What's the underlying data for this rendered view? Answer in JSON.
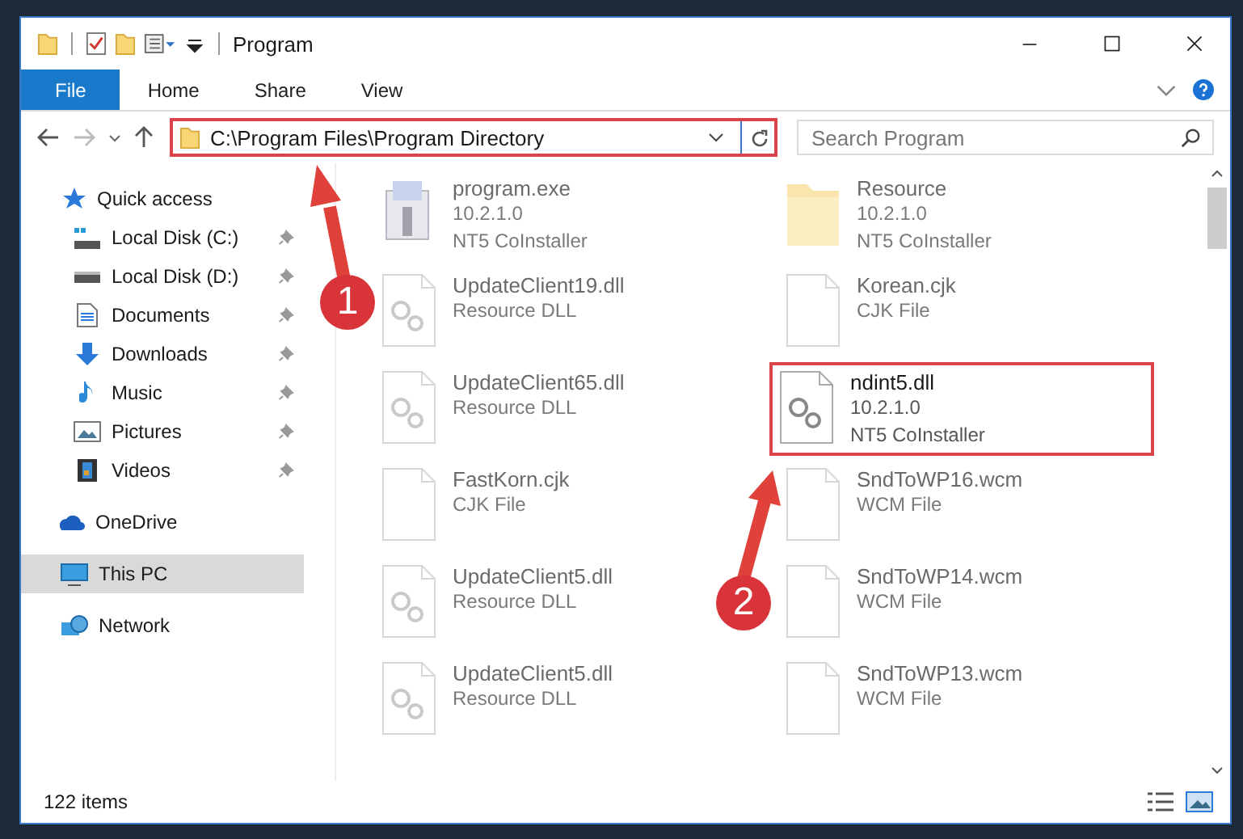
{
  "window": {
    "title": "Program"
  },
  "ribbon_tabs": [
    {
      "label": "File",
      "selected": true
    },
    {
      "label": "Home",
      "selected": false
    },
    {
      "label": "Share",
      "selected": false
    },
    {
      "label": "View",
      "selected": false
    }
  ],
  "address_bar": {
    "path": "C:\\Program Files\\Program Directory",
    "highlighted": true
  },
  "search": {
    "placeholder": "Search Program"
  },
  "navigation": [
    {
      "label": "Quick access",
      "kind": "star",
      "selected": false,
      "children": [
        {
          "label": "Local Disk (C:)",
          "kind": "drive-c",
          "pinned": true,
          "selected": false
        },
        {
          "label": "Local Disk (D:)",
          "kind": "drive",
          "pinned": true,
          "selected": false
        },
        {
          "label": "Documents",
          "kind": "document",
          "pinned": true,
          "selected": false
        },
        {
          "label": "Downloads",
          "kind": "download",
          "pinned": true,
          "selected": false
        },
        {
          "label": "Music",
          "kind": "music",
          "pinned": true,
          "selected": false
        },
        {
          "label": "Pictures",
          "kind": "pictures",
          "pinned": true,
          "selected": false
        },
        {
          "label": "Videos",
          "kind": "videos",
          "pinned": true,
          "selected": false
        }
      ]
    },
    {
      "label": "OneDrive",
      "kind": "cloud",
      "selected": false
    },
    {
      "label": "This PC",
      "kind": "pc",
      "selected": true
    },
    {
      "label": "Network",
      "kind": "network",
      "selected": false
    }
  ],
  "files": [
    {
      "name": "program.exe",
      "lines": [
        "10.2.1.0",
        "NT5 CoInstaller"
      ],
      "kind": "exe",
      "dimmed": true,
      "highlighted": false
    },
    {
      "name": "Resource",
      "lines": [
        "10.2.1.0",
        "NT5 CoInstaller"
      ],
      "kind": "folder",
      "dimmed": true,
      "highlighted": false
    },
    {
      "name": "UpdateClient19.dll",
      "lines": [
        "Resource DLL"
      ],
      "kind": "dll",
      "dimmed": true,
      "highlighted": false
    },
    {
      "name": "Korean.cjk",
      "lines": [
        "CJK File"
      ],
      "kind": "blank",
      "dimmed": true,
      "highlighted": false
    },
    {
      "name": "UpdateClient65.dll",
      "lines": [
        "Resource DLL"
      ],
      "kind": "dll",
      "dimmed": true,
      "highlighted": false
    },
    {
      "name": "ndint5.dll",
      "lines": [
        "10.2.1.0",
        "NT5 CoInstaller"
      ],
      "kind": "dll",
      "dimmed": false,
      "highlighted": true
    },
    {
      "name": "FastKorn.cjk",
      "lines": [
        "CJK File"
      ],
      "kind": "blank",
      "dimmed": true,
      "highlighted": false
    },
    {
      "name": "SndToWP16.wcm",
      "lines": [
        "WCM File"
      ],
      "kind": "blank",
      "dimmed": true,
      "highlighted": false
    },
    {
      "name": "UpdateClient5.dll",
      "lines": [
        "Resource DLL"
      ],
      "kind": "dll",
      "dimmed": true,
      "highlighted": false
    },
    {
      "name": "SndToWP14.wcm",
      "lines": [
        "WCM File"
      ],
      "kind": "blank",
      "dimmed": true,
      "highlighted": false
    },
    {
      "name": "UpdateClient5.dll",
      "lines": [
        "Resource DLL"
      ],
      "kind": "dll",
      "dimmed": true,
      "highlighted": false
    },
    {
      "name": "SndToWP13.wcm",
      "lines": [
        "WCM File"
      ],
      "kind": "blank",
      "dimmed": true,
      "highlighted": false
    }
  ],
  "status_bar": {
    "count": "122 items"
  },
  "annotations": [
    {
      "label": "1"
    },
    {
      "label": "2"
    }
  ]
}
